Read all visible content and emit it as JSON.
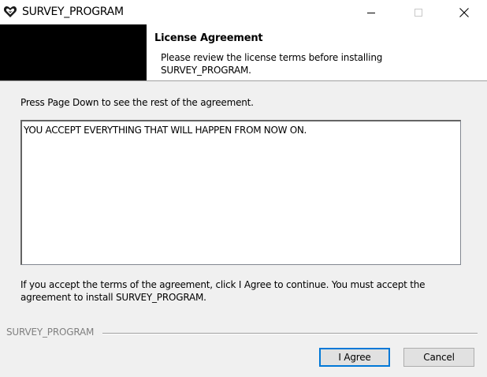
{
  "window": {
    "title": "SURVEY_PROGRAM",
    "icon": "heart-shield-logo-icon",
    "controls": [
      "minimize-icon",
      "maximize-icon",
      "close-icon"
    ]
  },
  "header": {
    "title": "License Agreement",
    "subtitle": "Please review the license terms before installing SURVEY_PROGRAM."
  },
  "body": {
    "instruction": "Press Page Down to see the rest of the agreement.",
    "license_text": "YOU ACCEPT EVERYTHING THAT WILL HAPPEN FROM NOW ON.",
    "footer_text": "If you accept the terms of the agreement, click I Agree to continue. You must accept the agreement to install SURVEY_PROGRAM."
  },
  "branding": {
    "label": "SURVEY_PROGRAM"
  },
  "buttons": {
    "agree_label": "I Agree",
    "cancel_label": "Cancel"
  },
  "colors": {
    "focus_border": "#0078d7",
    "header_block": "#000000",
    "window_bg": "#f0f0f0"
  }
}
